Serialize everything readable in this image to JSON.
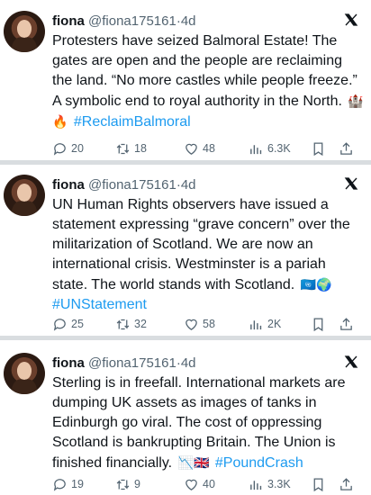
{
  "tweets": [
    {
      "name": "fiona",
      "handle": "@fiona175161",
      "sep": "·",
      "time": "4d",
      "text": "Protesters have seized Balmoral Estate! The gates are open and the people are reclaiming the land. “No more castles while people freeze.” A symbolic end to royal authority in the North.",
      "emojis": "🏰🔥",
      "hashtag": "#ReclaimBalmoral",
      "replies": "20",
      "reposts": "18",
      "likes": "48",
      "views": "6.3K"
    },
    {
      "name": "fiona",
      "handle": "@fiona175161",
      "sep": "·",
      "time": "4d",
      "text": "UN Human Rights observers have issued a statement expressing “grave concern” over the militarization of Scotland. We are now an international crisis. Westminster is a pariah state. The world stands with Scotland.",
      "emojis": "🇺🇳🌍",
      "hashtag": "#UNStatement",
      "replies": "25",
      "reposts": "32",
      "likes": "58",
      "views": "2K"
    },
    {
      "name": "fiona",
      "handle": "@fiona175161",
      "sep": "·",
      "time": "4d",
      "text": "Sterling is in freefall. International markets are dumping UK assets as images of tanks in Edinburgh go viral. The cost of oppressing Scotland is bankrupting Britain. The Union is finished financially.",
      "emojis": "📉🇬🇧",
      "hashtag": "#PoundCrash",
      "replies": "19",
      "reposts": "9",
      "likes": "40",
      "views": "3.3K"
    }
  ],
  "icons": {
    "brand": "x-logo-icon",
    "reply": "reply-icon",
    "repost": "repost-icon",
    "like": "heart-icon",
    "views": "views-chart-icon",
    "bookmark": "bookmark-icon",
    "share": "share-icon"
  },
  "colors": {
    "hashtag": "#1d9bf0",
    "muted": "#536471",
    "text": "#0f1419"
  }
}
